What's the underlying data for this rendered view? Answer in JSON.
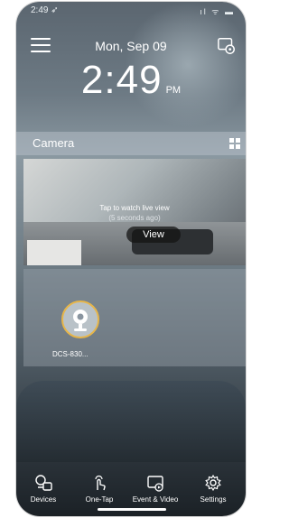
{
  "status_bar": {
    "time": "2:49 ➶",
    "icons": "ıl ᯤ ▬"
  },
  "header": {
    "date": "Mon, Sep 09",
    "time": "2:49",
    "ampm": "PM"
  },
  "section": {
    "title": "Camera"
  },
  "preview": {
    "tap_text": "Tap to watch live view",
    "ago_text": "(5 seconds ago)",
    "view_button": "View"
  },
  "device": {
    "name": "DCS-830..."
  },
  "tabs": [
    {
      "label": "Devices",
      "icon": "devices-icon"
    },
    {
      "label": "One-Tap",
      "icon": "one-tap-icon"
    },
    {
      "label": "Event & Video",
      "icon": "event-video-icon"
    },
    {
      "label": "Settings",
      "icon": "settings-icon"
    }
  ],
  "colors": {
    "accent": "#e7b64a"
  }
}
